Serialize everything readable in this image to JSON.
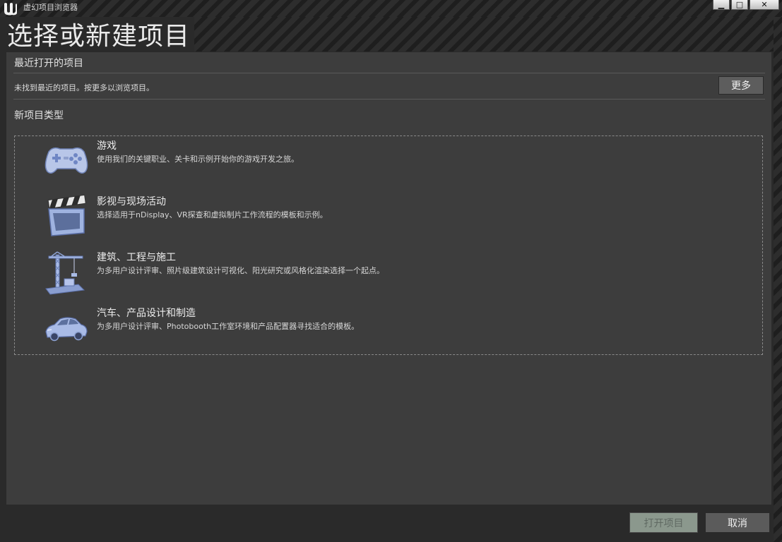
{
  "window": {
    "title": "虚幻项目浏览器",
    "logo": "unreal-logo",
    "controls": {
      "minimize": "▁",
      "maximize": "□",
      "close": "✕"
    }
  },
  "page_title": "选择或新建项目",
  "recent": {
    "title": "最近打开的项目",
    "message": "未找到最近的项目。按更多以浏览项目。",
    "more_label": "更多"
  },
  "new_types": {
    "title": "新项目类型",
    "items": [
      {
        "icon": "gamepad-icon",
        "name": "游戏",
        "desc": "使用我们的关键职业、关卡和示例开始你的游戏开发之旅。"
      },
      {
        "icon": "clapperboard-icon",
        "name": "影视与现场活动",
        "desc": "选择适用于nDisplay、VR探查和虚拟制片工作流程的模板和示例。"
      },
      {
        "icon": "crane-icon",
        "name": "建筑、工程与施工",
        "desc": "为多用户设计评审、照片级建筑设计可视化、阳光研究或风格化渲染选择一个起点。"
      },
      {
        "icon": "car-icon",
        "name": "汽车、产品设计和制造",
        "desc": "为多用户设计评审、Photobooth工作室环境和产品配置器寻找适合的模板。"
      }
    ]
  },
  "footer": {
    "open_label": "打开项目",
    "cancel_label": "取消"
  },
  "colors": {
    "panel": "#3d3d3d",
    "icon_blue": "#8fa4d4",
    "open_disabled": "#8b988d"
  }
}
